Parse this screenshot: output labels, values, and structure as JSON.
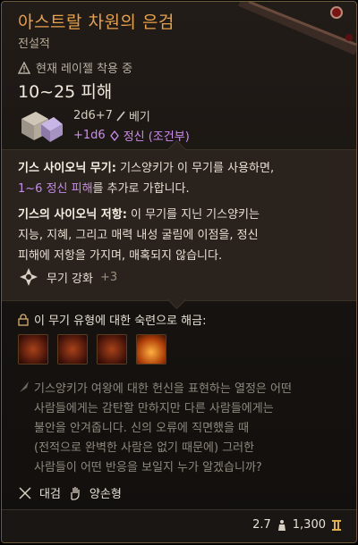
{
  "item": {
    "title": "아스트랄 차원의 은검",
    "rarity": "전설적",
    "requirement": "현재 레이젤 착용 중",
    "damage": "10~25 피해",
    "dice_row1": "2d6+7",
    "damage_type": "베기",
    "dice_row2": "+1d6",
    "psychic": "정신 (조건부)"
  },
  "abilities": {
    "a1_title": "기스 사이오닉 무기:",
    "a1_text1": " 기스양키가 이 무기를 사용하면,",
    "a1_hl": "1~6 정신 피해",
    "a1_text2": "를 추가로 가합니다.",
    "a2_title": "기스의 사이오닉 저항:",
    "a2_text1": " 이 무기를 지닌 기스양키는",
    "a2_text2": "지능, 지혜, 그리고 매력 내성 굴림에 이점을, 정신",
    "a2_text3": "피해에 저항을 가지며, 매혹되지 않습니다.",
    "enhance_label": "무기 강화",
    "enhance_value": "+3"
  },
  "proficiency": {
    "label": "이 무기 유형에 대한 숙련으로 해금:",
    "icons": [
      "skill-icon-1",
      "skill-icon-2",
      "skill-icon-3",
      "skill-icon-4"
    ]
  },
  "flavor": {
    "l1": "기스양키가 여왕에 대한 헌신을 표현하는 열정은 어떤",
    "l2": "사람들에게는 감탄할 만하지만 다른 사람들에게는",
    "l3": "불안을 안겨줍니다. 신의 오류에 직면했을 때",
    "l4": "(전적으로 완벽한 사람은 없기 때문에) 그러한",
    "l5": "사람들이 어떤 반응을 보일지 누가 알겠습니까?"
  },
  "properties": {
    "p1": "대검",
    "p2": "양손형"
  },
  "footer": {
    "weight": "2.7",
    "price": "1,300"
  },
  "colors": {
    "title": "#e8a24a",
    "psychic": "#c68bea",
    "text": "#e8e0d4",
    "muted": "#8e877c"
  }
}
